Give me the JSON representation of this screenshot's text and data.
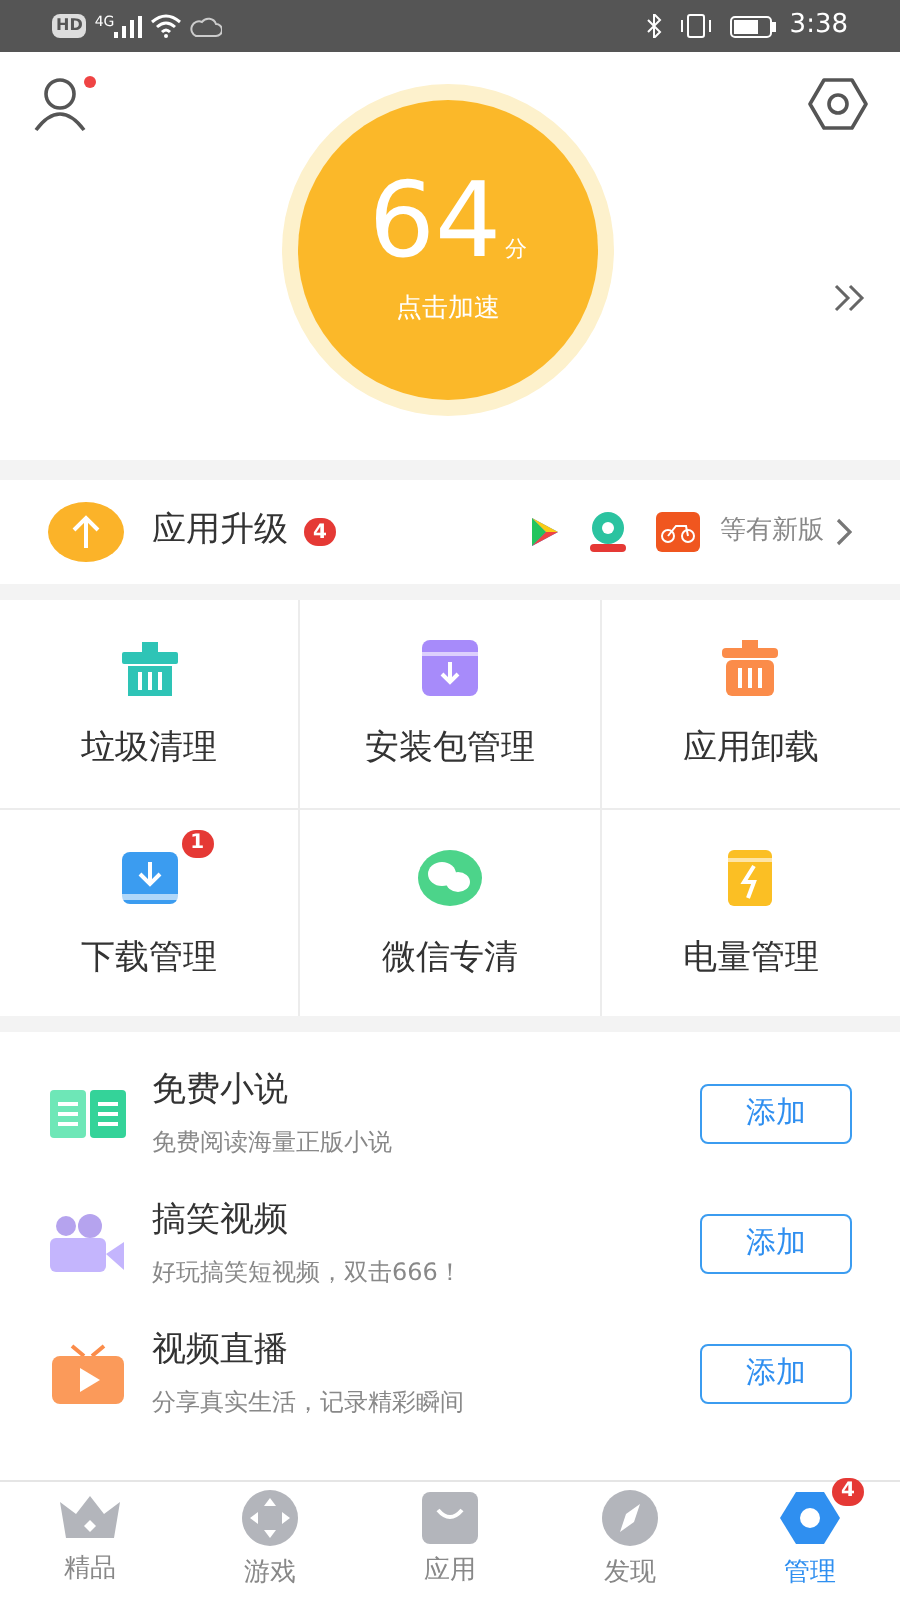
{
  "status_bar": {
    "hd": "HD",
    "network": "4G",
    "time": "3:38"
  },
  "header": {
    "notification_dot": true
  },
  "score": {
    "value": "64",
    "unit": "分",
    "action": "点击加速"
  },
  "upgrade": {
    "label": "应用升级",
    "badge": "4",
    "note": "等有新版"
  },
  "tools": [
    {
      "label": "垃圾清理",
      "kind": "trash",
      "color": "#2ec4b6"
    },
    {
      "label": "安装包管理",
      "kind": "package",
      "color": "#a78bfa"
    },
    {
      "label": "应用卸载",
      "kind": "uninstall",
      "color": "#fb8c4a"
    },
    {
      "label": "下载管理",
      "kind": "download",
      "color": "#3b9cf0",
      "badge": "1"
    },
    {
      "label": "微信专清",
      "kind": "wechat",
      "color": "#4cd48a"
    },
    {
      "label": "电量管理",
      "kind": "battery",
      "color": "#fbbf24"
    }
  ],
  "features": [
    {
      "title": "免费小说",
      "subtitle": "免费阅读海量正版小说",
      "kind": "book",
      "button": "添加"
    },
    {
      "title": "搞笑视频",
      "subtitle": "好玩搞笑短视频，双击666！",
      "kind": "camera",
      "button": "添加"
    },
    {
      "title": "视频直播",
      "subtitle": "分享真实生活，记录精彩瞬间",
      "kind": "tv",
      "button": "添加"
    }
  ],
  "nav": [
    {
      "label": "精品",
      "kind": "crown",
      "selected": false
    },
    {
      "label": "游戏",
      "kind": "gamepad",
      "selected": false
    },
    {
      "label": "应用",
      "kind": "bag",
      "selected": false
    },
    {
      "label": "发现",
      "kind": "compass",
      "selected": false
    },
    {
      "label": "管理",
      "kind": "gear",
      "selected": true,
      "badge": "4"
    }
  ]
}
